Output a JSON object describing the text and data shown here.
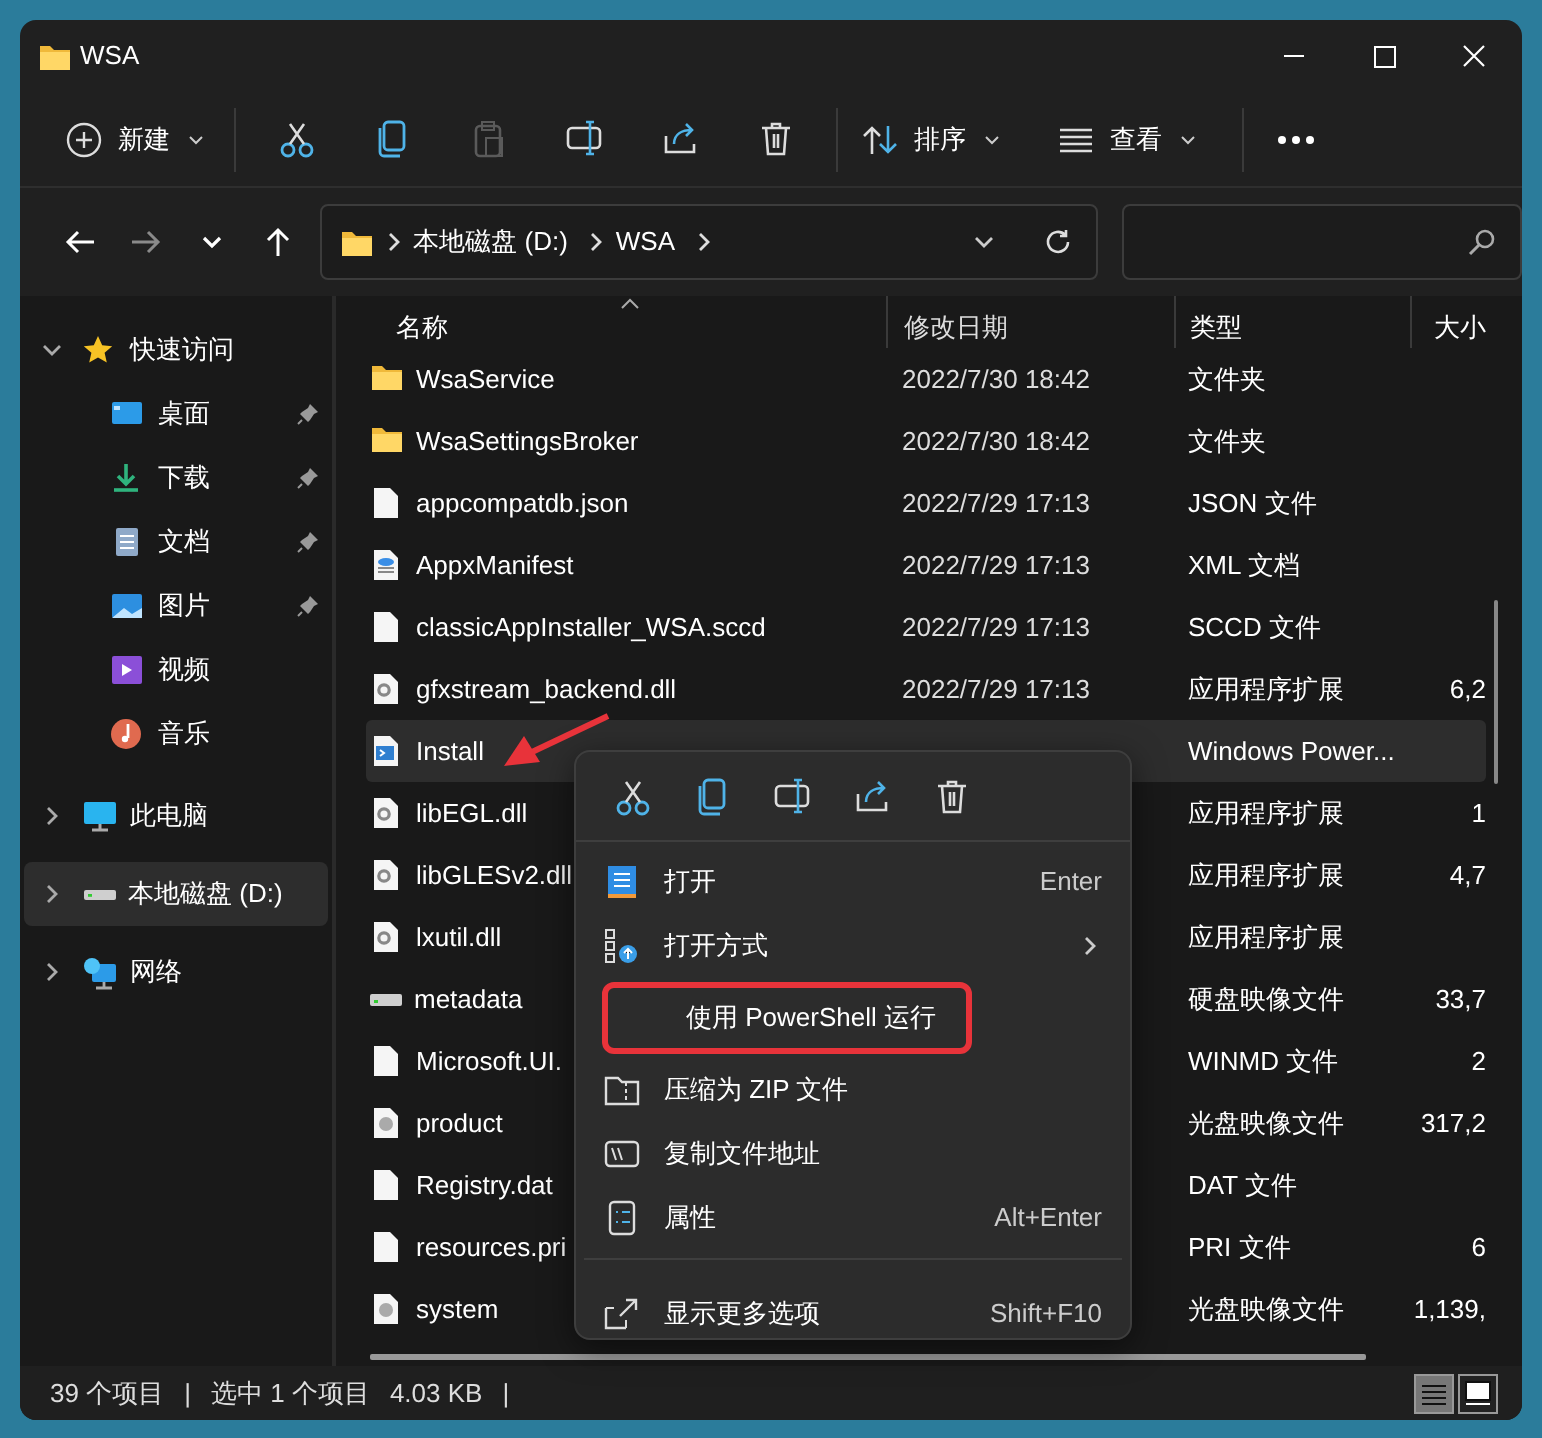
{
  "window": {
    "title": "WSA"
  },
  "toolbar": {
    "new_label": "新建",
    "actions": [
      {
        "disabled": false
      },
      {
        "disabled": false
      },
      {
        "disabled": true
      },
      {
        "disabled": false
      },
      {
        "disabled": false
      },
      {
        "disabled": false
      }
    ],
    "sort_label": "排序",
    "view_label": "查看"
  },
  "navigation": [
    {
      "disabled": false
    },
    {
      "disabled": true
    },
    {
      "disabled": false
    },
    {
      "disabled": false
    }
  ],
  "address": {
    "segments": [
      "本地磁盘 (D:)",
      "WSA"
    ]
  },
  "sidebar": {
    "items": [
      {
        "label": "快速访问",
        "kind": "star",
        "expanded": true,
        "selected": false,
        "children": [
          {
            "label": "桌面",
            "kind": "desktop",
            "pinned": true
          },
          {
            "label": "下载",
            "kind": "download",
            "pinned": true
          },
          {
            "label": "文档",
            "kind": "documents",
            "pinned": true
          },
          {
            "label": "图片",
            "kind": "pictures",
            "pinned": true
          },
          {
            "label": "视频",
            "kind": "videos",
            "pinned": false
          },
          {
            "label": "音乐",
            "kind": "music",
            "pinned": false
          }
        ]
      },
      {
        "label": "此电脑",
        "kind": "pc",
        "expanded": false,
        "selected": false
      },
      {
        "label": "本地磁盘 (D:)",
        "kind": "drive",
        "expanded": false,
        "selected": true
      },
      {
        "label": "网络",
        "kind": "network",
        "expanded": false,
        "selected": false
      }
    ]
  },
  "table": {
    "columns": [
      {
        "label": "名称",
        "sorted": true
      },
      {
        "label": "修改日期",
        "sorted": false
      },
      {
        "label": "类型",
        "sorted": false
      },
      {
        "label": "大小",
        "sorted": false
      }
    ],
    "rows": [
      {
        "name": "WsaService",
        "date": "2022/7/30 18:42",
        "type": "文件夹",
        "kind": "folder",
        "selected": false
      },
      {
        "name": "WsaSettingsBroker",
        "date": "2022/7/30 18:42",
        "type": "文件夹",
        "kind": "folder",
        "selected": false
      },
      {
        "name": "appcompatdb.json",
        "date": "2022/7/29 17:13",
        "type": "JSON 文件",
        "kind": "file",
        "selected": false
      },
      {
        "name": "AppxManifest",
        "date": "2022/7/29 17:13",
        "type": "XML 文档",
        "kind": "markup",
        "selected": false
      },
      {
        "name": "classicAppInstaller_WSA.sccd",
        "date": "2022/7/29 17:13",
        "type": "SCCD 文件",
        "kind": "file",
        "selected": false
      },
      {
        "name": "gfxstream_backend.dll",
        "date": "2022/7/29 17:13",
        "type": "应用程序扩展",
        "size": "6,2",
        "kind": "library",
        "selected": false
      },
      {
        "name": "Install",
        "type": "Windows Power...",
        "kind": "script",
        "selected": true
      },
      {
        "name": "libEGL.dll",
        "type": "应用程序扩展",
        "size": "1",
        "kind": "library",
        "selected": false
      },
      {
        "name": "libGLESv2.dll",
        "type": "应用程序扩展",
        "size": "4,7",
        "kind": "library",
        "selected": false
      },
      {
        "name": "lxutil.dll",
        "type": "应用程序扩展",
        "kind": "library",
        "selected": false
      },
      {
        "name": "metadata",
        "type": "硬盘映像文件",
        "size": "33,7",
        "kind": "drive",
        "selected": false
      },
      {
        "name": "Microsoft.UI.",
        "type": "WINMD 文件",
        "size": "2",
        "kind": "file",
        "selected": false
      },
      {
        "name": "product",
        "type": "光盘映像文件",
        "size": "317,2",
        "kind": "disc",
        "selected": false
      },
      {
        "name": "Registry.dat",
        "type": "DAT 文件",
        "kind": "file",
        "selected": false
      },
      {
        "name": "resources.pri",
        "type": "PRI 文件",
        "size": "6",
        "kind": "file",
        "selected": false
      },
      {
        "name": "system",
        "type": "光盘映像文件",
        "size": "1,139,",
        "kind": "disc",
        "selected": false
      }
    ]
  },
  "context_menu": {
    "items": [
      {
        "label": "打开",
        "shortcut": "Enter",
        "kind": "open",
        "submenu": false,
        "outlined": false,
        "divider_before": false
      },
      {
        "label": "打开方式",
        "kind": "open-with",
        "submenu": true,
        "outlined": false,
        "divider_before": false
      },
      {
        "label": "使用 PowerShell 运行",
        "kind": "none",
        "submenu": false,
        "outlined": true,
        "divider_before": false
      },
      {
        "label": "压缩为 ZIP 文件",
        "kind": "zip",
        "submenu": false,
        "outlined": false,
        "divider_before": false
      },
      {
        "label": "复制文件地址",
        "kind": "path",
        "submenu": false,
        "outlined": false,
        "divider_before": false
      },
      {
        "label": "属性",
        "shortcut": "Alt+Enter",
        "kind": "properties",
        "submenu": false,
        "outlined": false,
        "divider_before": false
      },
      {
        "label": "显示更多选项",
        "shortcut": "Shift+F10",
        "kind": "more",
        "submenu": false,
        "outlined": false,
        "divider_before": true
      }
    ]
  },
  "status_bar": {
    "texts": [
      "39 个项目",
      "|",
      "选中 1 个项目",
      "4.03 KB",
      "|"
    ],
    "views": [
      {
        "selected": true
      },
      {
        "selected": false
      }
    ]
  }
}
